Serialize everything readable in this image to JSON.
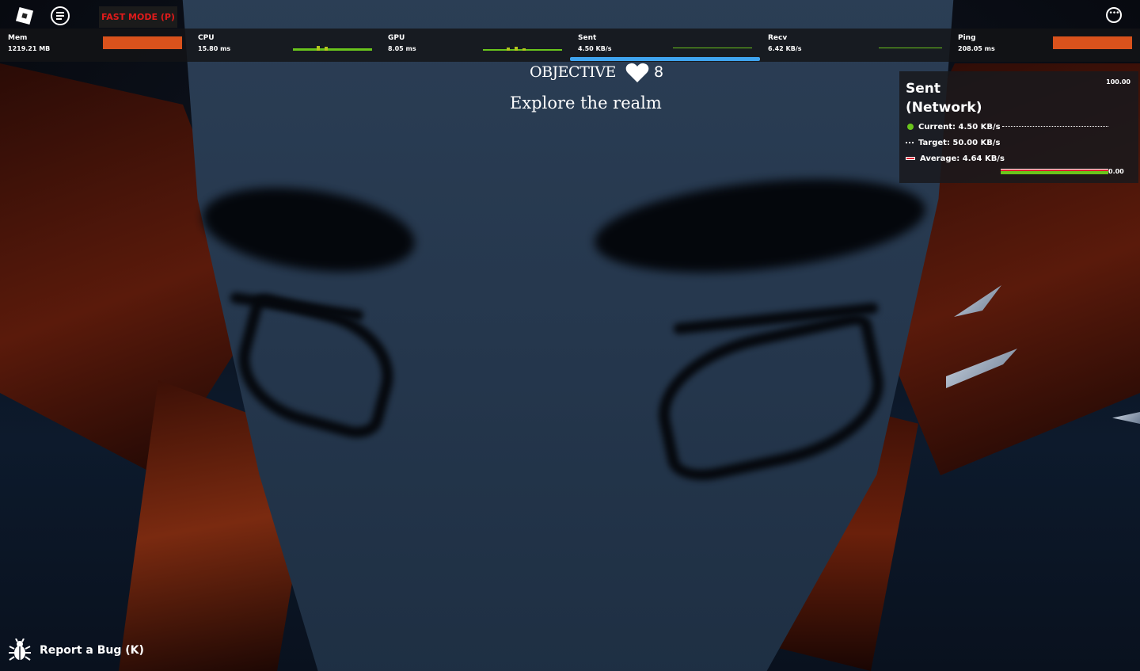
{
  "topbar": {
    "menu_icon": "roblox-logo-icon",
    "chat_icon": "chat-icon",
    "fast_mode_label": "FAST MODE (P)",
    "more_icon": "more-options-icon"
  },
  "stats": [
    {
      "label": "Mem",
      "value": "1219.21 MB",
      "display": "bar"
    },
    {
      "label": "CPU",
      "value": "15.80 ms",
      "display": "graph"
    },
    {
      "label": "GPU",
      "value": "8.05 ms",
      "display": "graph"
    },
    {
      "label": "Sent",
      "value": "4.50 KB/s",
      "display": "line",
      "selected": true
    },
    {
      "label": "Recv",
      "value": "6.42 KB/s",
      "display": "line"
    },
    {
      "label": "Ping",
      "value": "208.05 ms",
      "display": "bar"
    }
  ],
  "hud": {
    "objective_title": "OBJECTIVE",
    "hearts": "8",
    "objective_text": "Explore the realm"
  },
  "network_panel": {
    "title": "Sent (Network)",
    "axis_max": "100.00",
    "axis_min": "0.00",
    "current": "Current: 4.50 KB/s",
    "target": "Target: 50.00 KB/s",
    "average": "Average: 4.64 KB/s"
  },
  "report_bug": {
    "label": "Report a Bug (K)",
    "icon": "bug-icon"
  },
  "colors": {
    "bar_orange": "#d9521c",
    "graph_green": "#6ac51c",
    "selected_blue": "#3fa4ef",
    "fast_mode_red": "#e01b1b"
  }
}
